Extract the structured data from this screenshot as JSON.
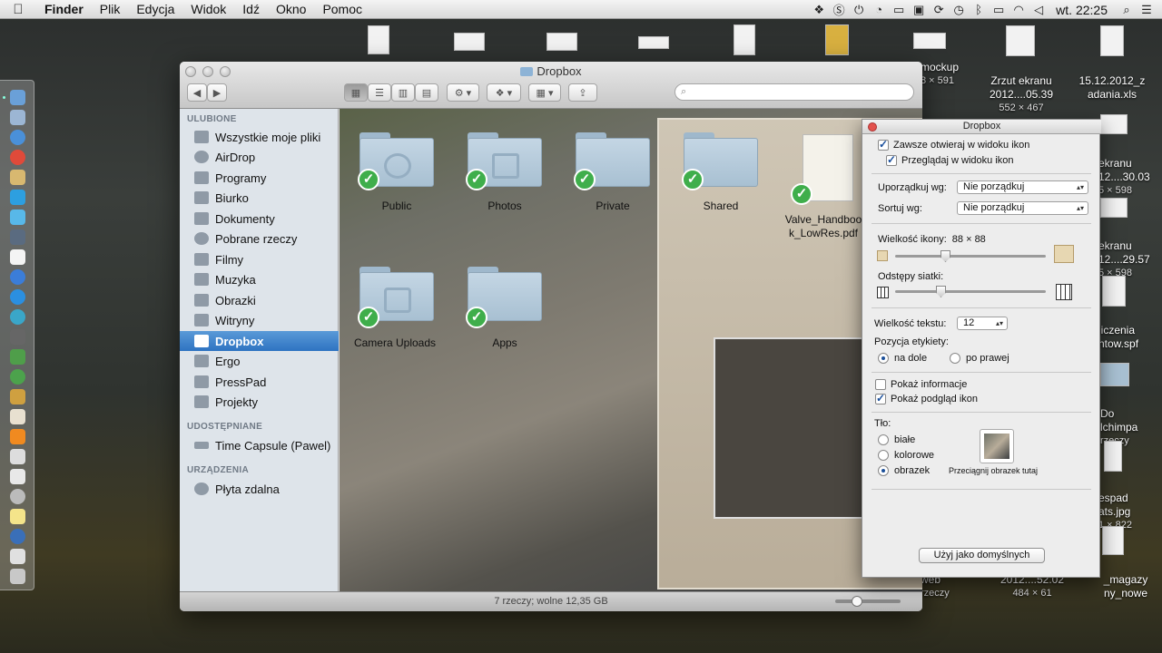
{
  "menubar": {
    "apple": "",
    "items": [
      "Finder",
      "Plik",
      "Edycja",
      "Widok",
      "Idź",
      "Okno",
      "Pomoc"
    ],
    "clock": "wt. 22:25",
    "status_icons": [
      "dropbox-icon",
      "skype-icon",
      "power-icon",
      "gauge-icon",
      "airplay-icon",
      "display-icon",
      "sync-icon",
      "time-machine-icon",
      "bluetooth-icon",
      "battery-icon",
      "wifi-icon",
      "volume-icon",
      "spotlight-icon",
      "list-icon"
    ]
  },
  "desktop": {
    "files": [
      {
        "name": "mockup",
        "sub": "8 × 591"
      },
      {
        "name": "Zrzut ekranu\n2012....05.39",
        "sub": "552 × 467"
      },
      {
        "name": "15.12.2012_z\nadania.xls",
        "sub": ""
      },
      {
        "name": "ekranu\n12....30.03",
        "sub": "5 × 598"
      },
      {
        "name": "ekranu\n12....29.57",
        "sub": "5 × 598"
      },
      {
        "name": "liczenia\nntow.spf",
        "sub": ""
      },
      {
        "name": "Do\nlchimpa",
        "sub": "rzeczy"
      },
      {
        "name": "espad\nats.jpg",
        "sub": "1 × 822"
      },
      {
        "name": "_magazy\nny_nowe",
        "sub": ""
      },
      {
        "name": "2012....52.02",
        "sub": "484 × 61"
      },
      {
        "name": "web",
        "sub": "rzeczy"
      }
    ]
  },
  "finder": {
    "title": "Dropbox",
    "search_placeholder": "",
    "sidebar": {
      "favorites_header": "ULUBIONE",
      "favorites": [
        "Wszystkie moje pliki",
        "AirDrop",
        "Programy",
        "Biurko",
        "Dokumenty",
        "Pobrane rzeczy",
        "Filmy",
        "Muzyka",
        "Obrazki",
        "Witryny",
        "Dropbox",
        "Ergo",
        "PressPad",
        "Projekty"
      ],
      "shared_header": "UDOSTĘPNIANE",
      "shared": [
        "Time Capsule (Pawel)"
      ],
      "devices_header": "URZĄDZENIA",
      "devices": [
        "Płyta zdalna"
      ]
    },
    "items": [
      "Public",
      "Photos",
      "Private",
      "Shared",
      "Valve_Handbook_LowRes.pdf",
      "Camera Uploads",
      "Apps"
    ],
    "status": "7 rzeczy; wolne 12,35 GB"
  },
  "view_options": {
    "title": "Dropbox",
    "always_open": "Zawsze otwieraj w widoku ikon",
    "browse_in": "Przeglądaj w widoku ikon",
    "arrange_label": "Uporządkuj wg:",
    "arrange_value": "Nie porządkuj",
    "sort_label": "Sortuj wg:",
    "sort_value": "Nie porządkuj",
    "icon_size_label": "Wielkość ikony:",
    "icon_size_value": "88 × 88",
    "grid_spacing_label": "Odstępy siatki:",
    "text_size_label": "Wielkość tekstu:",
    "text_size_value": "12",
    "label_position_label": "Pozycja etykiety:",
    "label_bottom": "na dole",
    "label_right": "po prawej",
    "show_info": "Pokaż informacje",
    "show_preview": "Pokaż podgląd ikon",
    "background_label": "Tło:",
    "bg_white": "białe",
    "bg_color": "kolorowe",
    "bg_picture": "obrazek",
    "drag_picture": "Przeciągnij obrazek tutaj",
    "use_default": "Użyj jako domyślnych"
  }
}
